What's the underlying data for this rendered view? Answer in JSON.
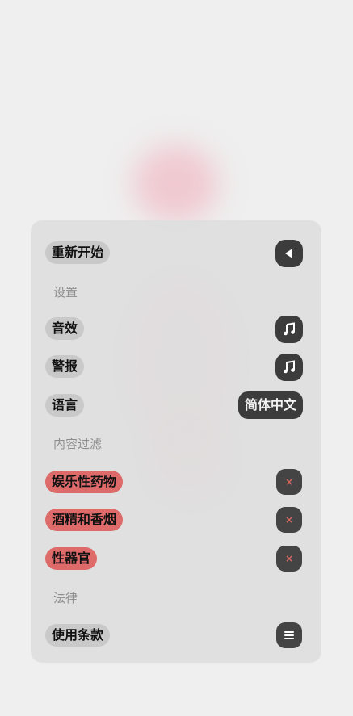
{
  "menu": {
    "restart": {
      "label": "重新开始",
      "icon": "play-back-icon"
    },
    "settings_header": "设置",
    "sound": {
      "label": "音效",
      "icon": "music-note-icon"
    },
    "alert": {
      "label": "警报",
      "icon": "music-note-icon"
    },
    "language": {
      "label": "语言",
      "value": "简体中文"
    },
    "filter_header": "内容过滤",
    "filters": [
      {
        "label": "娱乐性药物",
        "icon": "close-icon"
      },
      {
        "label": "酒精和香烟",
        "icon": "close-icon"
      },
      {
        "label": "性器官",
        "icon": "close-icon"
      }
    ],
    "legal_header": "法律",
    "terms": {
      "label": "使用条款",
      "icon": "menu-icon"
    }
  },
  "colors": {
    "accent_red": "#de6a6a",
    "pill_gray": "#c9c9c9",
    "button_dark": "#3c3c3c",
    "x_mark": "#d9655f"
  },
  "x_glyph": "×"
}
